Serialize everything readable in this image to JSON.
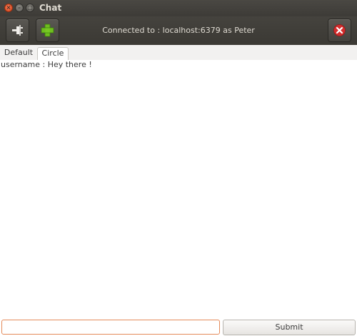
{
  "window": {
    "title": "Chat",
    "controls": [
      "close-icon",
      "minimize-icon",
      "maximize-icon"
    ]
  },
  "toolbar": {
    "disconnect_icon": "plug-icon",
    "add_icon": "plus-icon",
    "quit_icon": "close-circle-icon",
    "status": "Connected to : localhost:6379 as Peter"
  },
  "tabs": [
    {
      "label": "Default",
      "selected": false
    },
    {
      "label": "Circle",
      "selected": true
    }
  ],
  "messages": [
    {
      "text": "username : Hey there !"
    }
  ],
  "composer": {
    "value": "",
    "placeholder": "",
    "submit_label": "Submit"
  },
  "colors": {
    "titlebar": "#3d3b37",
    "accent_plus": "#6fbf1f",
    "quit_red": "#d32d2d",
    "input_focus": "#e48a5a"
  }
}
